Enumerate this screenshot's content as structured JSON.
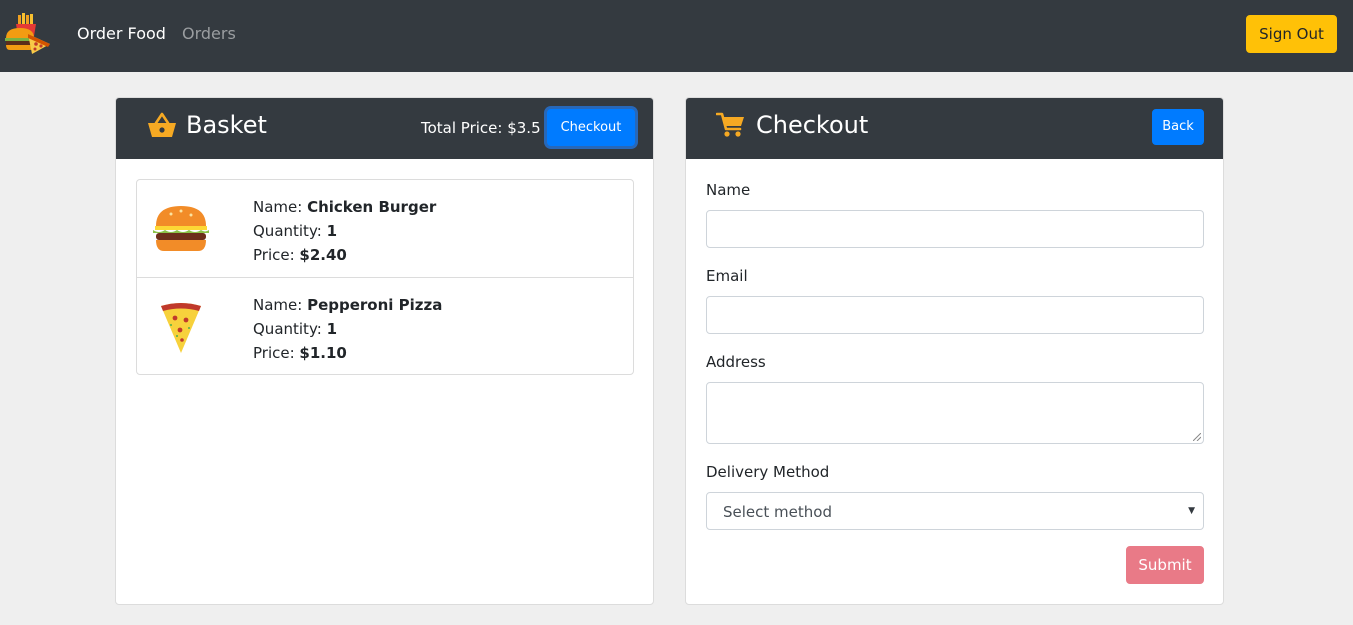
{
  "nav": {
    "logo_icon": "food-logo-icon",
    "links": [
      {
        "label": "Order Food",
        "active": true
      },
      {
        "label": "Orders",
        "active": false
      }
    ],
    "sign_out_label": "Sign Out"
  },
  "basket": {
    "icon": "basket-icon",
    "title": "Basket",
    "total_price": "Total Price: $3.5",
    "checkout_label": "Checkout",
    "items": [
      {
        "icon": "burger-icon",
        "name_label": "Name: ",
        "name": "Chicken Burger",
        "quantity_label": "Quantity: ",
        "quantity": "1",
        "price_label": "Price: ",
        "price": "$2.40"
      },
      {
        "icon": "pizza-icon",
        "name_label": "Name: ",
        "name": "Pepperoni Pizza",
        "quantity_label": "Quantity: ",
        "quantity": "1",
        "price_label": "Price: ",
        "price": "$1.10"
      }
    ]
  },
  "checkout": {
    "icon": "cart-icon",
    "title": "Checkout",
    "back_label": "Back",
    "form": {
      "name_label": "Name",
      "name_value": "",
      "email_label": "Email",
      "email_value": "",
      "address_label": "Address",
      "address_value": "",
      "delivery_label": "Delivery Method",
      "delivery_selected": "Select method",
      "submit_label": "Submit"
    }
  },
  "colors": {
    "navbar": "#343a40",
    "background": "#efefef",
    "primary": "#007bff",
    "warning": "#ffc107",
    "submit_disabled": "#e97a87",
    "accent_icon": "#f6a923"
  }
}
